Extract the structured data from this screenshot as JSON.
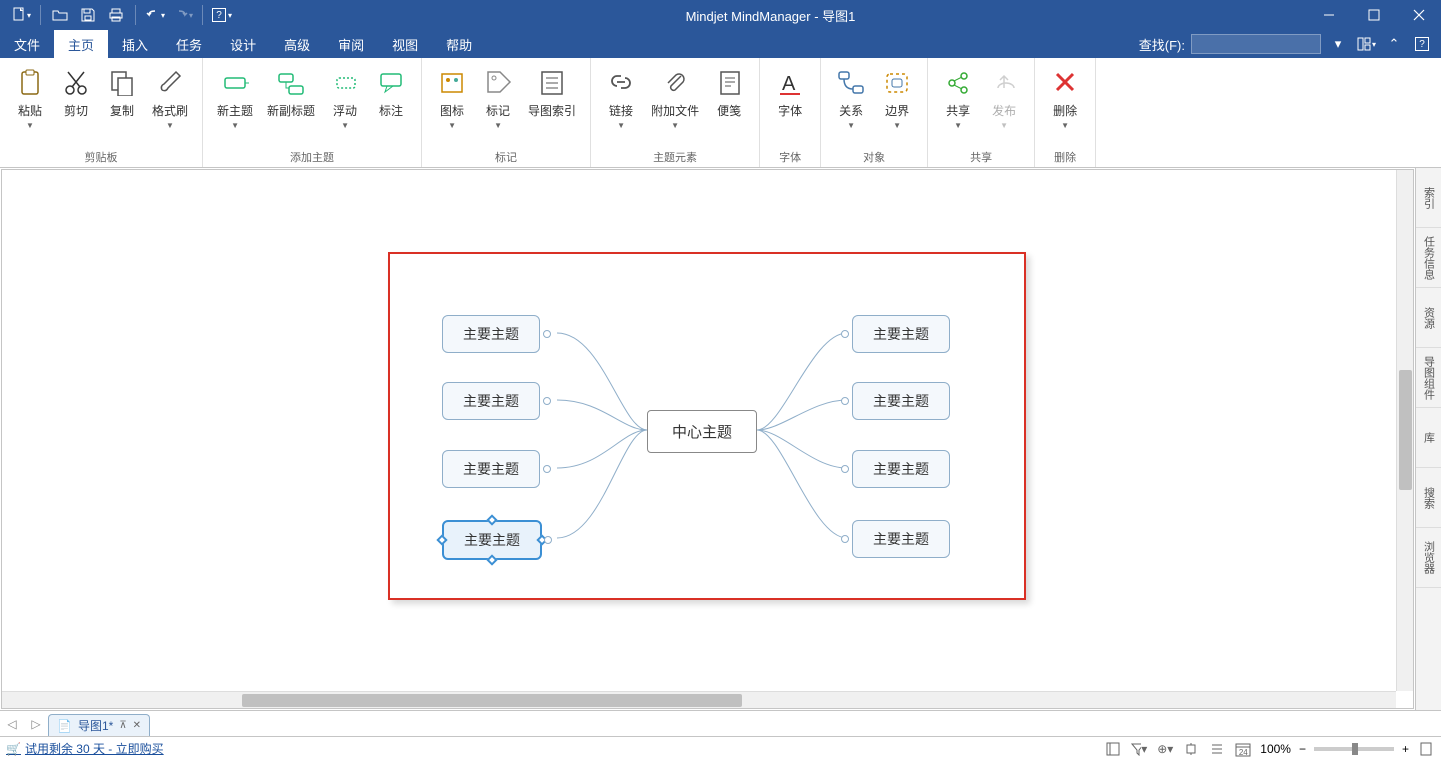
{
  "app": {
    "title": "Mindjet MindManager - 导图1"
  },
  "menu": {
    "items": [
      "文件",
      "主页",
      "插入",
      "任务",
      "设计",
      "高级",
      "审阅",
      "视图",
      "帮助"
    ],
    "active_index": 1,
    "search_label": "查找(F):"
  },
  "ribbon": {
    "groups": [
      {
        "label": "剪贴板",
        "buttons": [
          {
            "label": "粘贴",
            "icon": "clipboard",
            "arrow": true
          },
          {
            "label": "剪切",
            "icon": "scissors"
          },
          {
            "label": "复制",
            "icon": "copy"
          },
          {
            "label": "格式刷",
            "icon": "brush",
            "arrow": true
          }
        ]
      },
      {
        "label": "添加主题",
        "buttons": [
          {
            "label": "新主题",
            "icon": "topic-new",
            "arrow": true
          },
          {
            "label": "新副标题",
            "icon": "topic-sub"
          },
          {
            "label": "浮动",
            "icon": "topic-float",
            "arrow": true
          },
          {
            "label": "标注",
            "icon": "callout"
          }
        ]
      },
      {
        "label": "标记",
        "buttons": [
          {
            "label": "图标",
            "icon": "icons",
            "arrow": true
          },
          {
            "label": "标记",
            "icon": "tag",
            "arrow": true
          },
          {
            "label": "导图索引",
            "icon": "index"
          }
        ]
      },
      {
        "label": "主题元素",
        "buttons": [
          {
            "label": "链接",
            "icon": "link",
            "arrow": true
          },
          {
            "label": "附加文件",
            "icon": "attach",
            "arrow": true
          },
          {
            "label": "便笺",
            "icon": "note"
          }
        ]
      },
      {
        "label": "字体",
        "buttons": [
          {
            "label": "字体",
            "icon": "font"
          }
        ]
      },
      {
        "label": "对象",
        "buttons": [
          {
            "label": "关系",
            "icon": "relation",
            "arrow": true
          },
          {
            "label": "边界",
            "icon": "boundary",
            "arrow": true
          }
        ]
      },
      {
        "label": "共享",
        "buttons": [
          {
            "label": "共享",
            "icon": "share",
            "arrow": true
          },
          {
            "label": "发布",
            "icon": "publish",
            "arrow": true,
            "disabled": true
          }
        ]
      },
      {
        "label": "删除",
        "buttons": [
          {
            "label": "删除",
            "icon": "delete-x",
            "arrow": true
          }
        ]
      }
    ]
  },
  "mindmap": {
    "center": "中心主题",
    "left_topics": [
      "主要主题",
      "主要主题",
      "主要主题",
      "主要主题"
    ],
    "right_topics": [
      "主要主题",
      "主要主题",
      "主要主题",
      "主要主题"
    ],
    "selected": {
      "side": "left",
      "index": 3
    }
  },
  "side_panel": [
    "索引",
    "任务信息",
    "资源",
    "导图组件",
    "库",
    "搜索",
    "浏览器"
  ],
  "doc_tab": {
    "name": "导图1*"
  },
  "status": {
    "trial_text": "试用剩余 30 天 - 立即购买",
    "zoom": "100%",
    "date_badge": "24"
  }
}
